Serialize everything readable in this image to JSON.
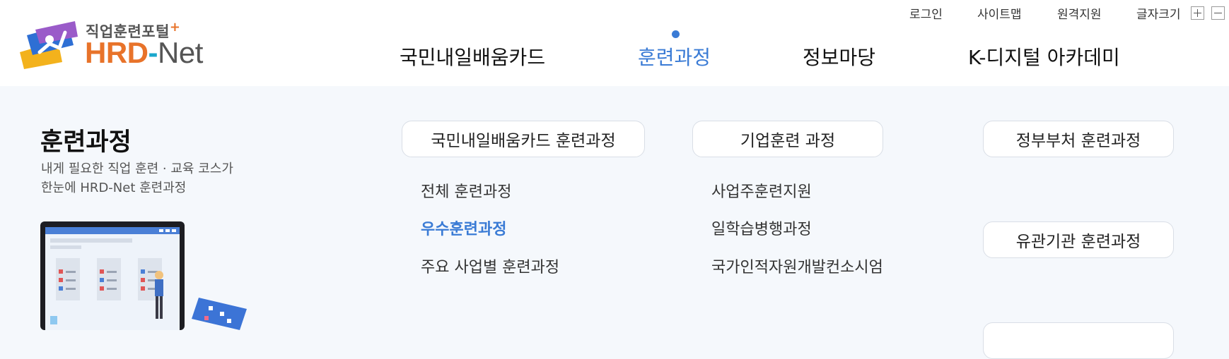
{
  "utility": {
    "login": "로그인",
    "sitemap": "사이트맵",
    "remote_support": "원격지원",
    "font_size": "글자크기",
    "font_plus_icon": "plus-icon",
    "font_minus_icon": "minus-icon"
  },
  "logo": {
    "subtitle": "직업훈련포털",
    "plus_mark": "+",
    "brand_part1": "HRD",
    "brand_dash": "-",
    "brand_part2": "Net"
  },
  "gnb": {
    "items": [
      {
        "label": "국민내일배움카드"
      },
      {
        "label": "훈련과정"
      },
      {
        "label": "정보마당"
      },
      {
        "label": "K-디지털 아카데미"
      }
    ],
    "active_index": 1
  },
  "section": {
    "title": "훈련과정",
    "desc_line1": "내게 필요한 직업 훈련 · 교육 코스가",
    "desc_line2": "한눈에 HRD-Net 훈련과정"
  },
  "categories": {
    "card": "국민내일배움카드 훈련과정",
    "enterprise": "기업훈련 과정",
    "government": "정부부처 훈련과정",
    "related": "유관기관 훈련과정"
  },
  "card_links": [
    {
      "label": "전체 훈련과정"
    },
    {
      "label": "우수훈련과정"
    },
    {
      "label": "주요 사업별 훈련과정"
    }
  ],
  "enterprise_links": [
    {
      "label": "사업주훈련지원"
    },
    {
      "label": "일학습병행과정"
    },
    {
      "label": "국가인적자원개발컨소시엄"
    }
  ],
  "colors": {
    "accent": "#3a7bd5",
    "brand_orange": "#e8732a",
    "panel_bg": "#f5f8fc"
  }
}
